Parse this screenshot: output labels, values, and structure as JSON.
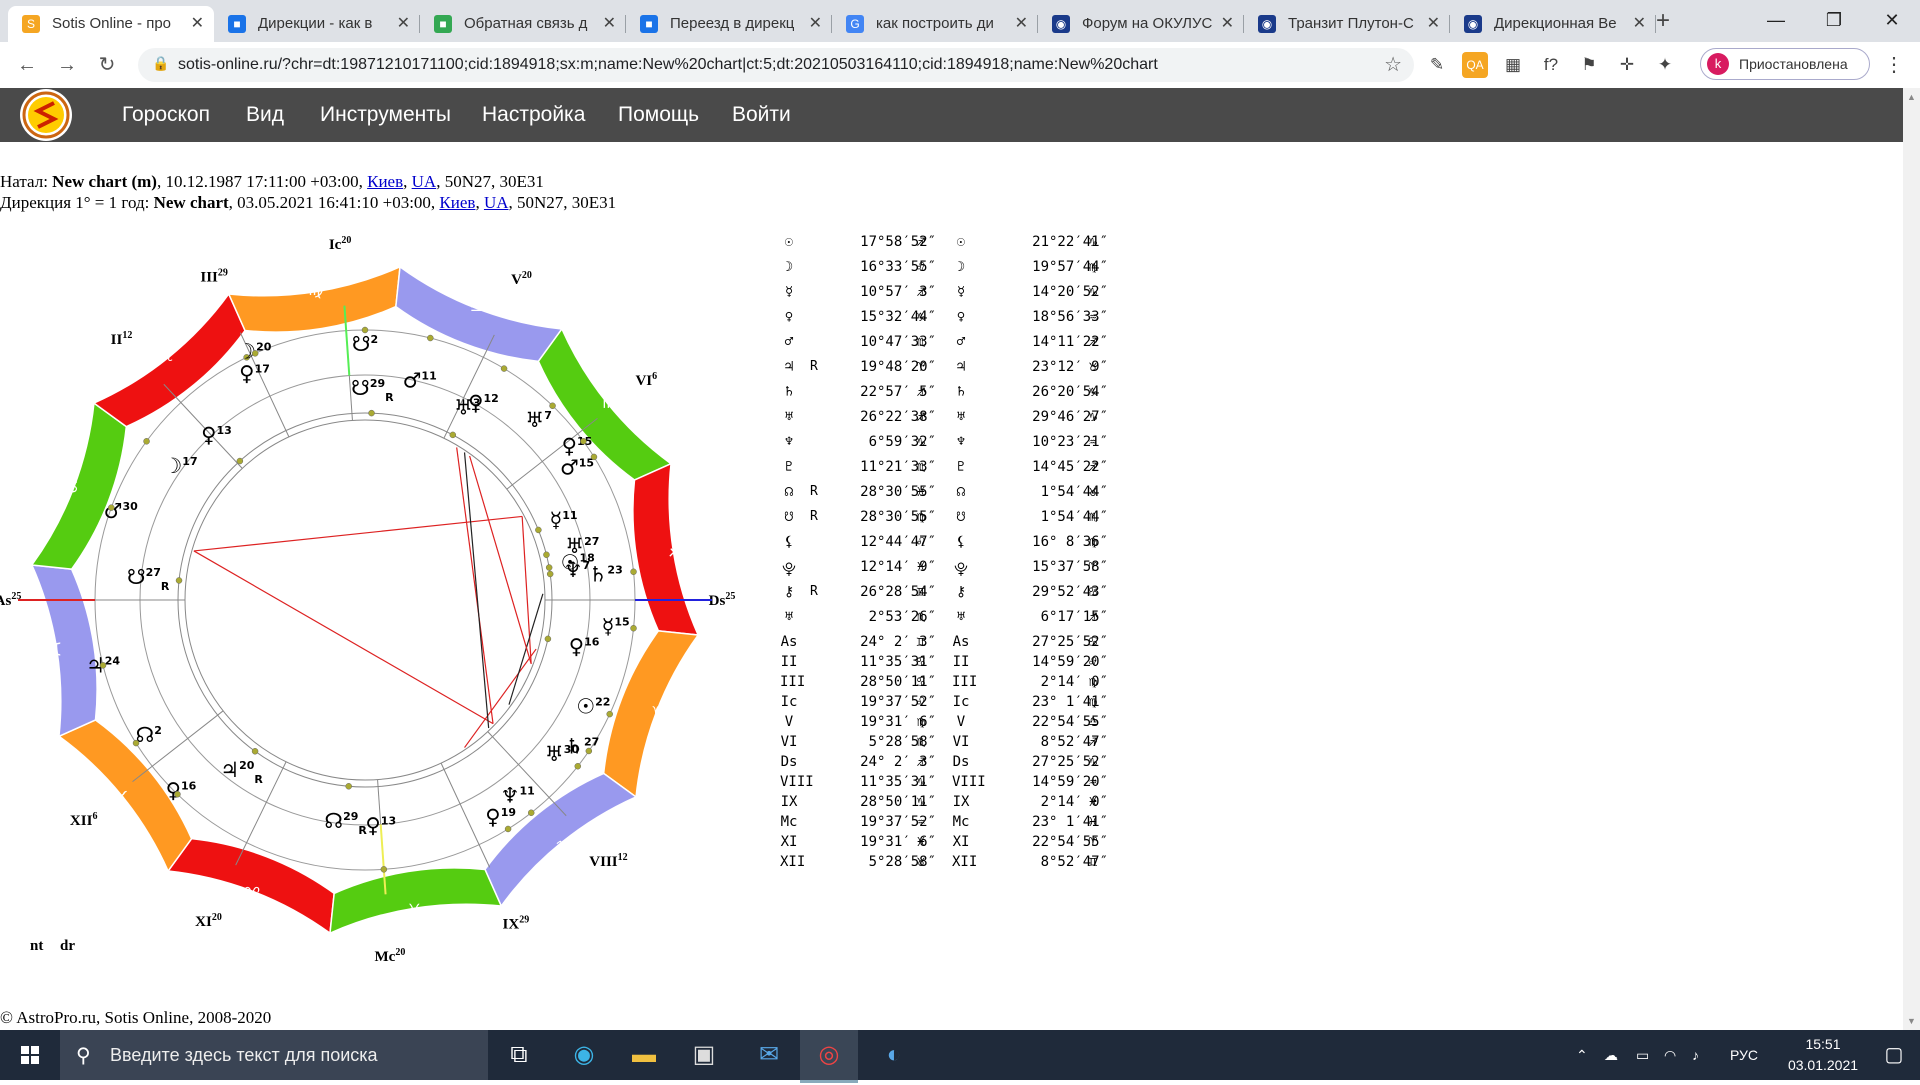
{
  "browser": {
    "tabs": [
      {
        "title": "Sotis Online - про",
        "active": true,
        "fav_color": "#f5a623",
        "fav_glyph": "S"
      },
      {
        "title": "Дирекции - как в",
        "active": false,
        "fav_color": "#1a73e8",
        "fav_glyph": "■"
      },
      {
        "title": "Обратная связь д",
        "active": false,
        "fav_color": "#34a853",
        "fav_glyph": "■"
      },
      {
        "title": "Переезд в дирекц",
        "active": false,
        "fav_color": "#1a73e8",
        "fav_glyph": "■"
      },
      {
        "title": "как построить ди",
        "active": false,
        "fav_color": "#4285f4",
        "fav_glyph": "G"
      },
      {
        "title": "Форум на ОКУЛУС",
        "active": false,
        "fav_color": "#1a3a8a",
        "fav_glyph": "◉"
      },
      {
        "title": "Транзит Плутон-С",
        "active": false,
        "fav_color": "#1a3a8a",
        "fav_glyph": "◉"
      },
      {
        "title": "Дирекционная Ве",
        "active": false,
        "fav_color": "#1a3a8a",
        "fav_glyph": "◉"
      }
    ],
    "close_glyph": "✕",
    "new_tab_glyph": "+",
    "minimize_glyph": "—",
    "maximize_glyph": "❐",
    "window_close_glyph": "✕",
    "back_glyph": "←",
    "forward_glyph": "→",
    "reload_glyph": "↻",
    "lock_glyph": "🔒",
    "url": "sotis-online.ru/?chr=dt:19871210171100;cid:1894918;sx:m;name:New%20chart|ct:5;dt:20210503164110;cid:1894918;name:New%20chart",
    "star_glyph": "☆",
    "extensions": [
      "✎",
      "QA",
      "▦",
      "f?",
      "⚑",
      "✛",
      "✦"
    ],
    "profile_initial": "k",
    "profile_status": "Приостановлена",
    "menu_glyph": "⋮"
  },
  "site": {
    "nav": [
      "Гороскоп",
      "Вид",
      "Инструменты",
      "Настройка",
      "Помощь",
      "Войти"
    ]
  },
  "natal": {
    "prefix": "Натал: ",
    "name": "New chart (m)",
    "datetime": ", 10.12.1987 17:11:00 +03:00, ",
    "city": "Киев",
    "country": "UA",
    "coords": ", 50N27, 30E31"
  },
  "direction": {
    "prefix": "Дирекция 1° = 1 год: ",
    "name": "New chart",
    "datetime": ", 03.05.2021 16:41:10 +03:00, ",
    "city": "Киев",
    "country": "UA",
    "coords": ", 50N27, 30E31"
  },
  "chart_labels": {
    "natal": "nt",
    "direction": "dr"
  },
  "zodiac_signs": [
    {
      "glyph": "♈",
      "color": "#ee1111"
    },
    {
      "glyph": "♉",
      "color": "#ff9922"
    },
    {
      "glyph": "♊",
      "color": "#9999ee"
    },
    {
      "glyph": "♋",
      "color": "#55cc11"
    },
    {
      "glyph": "♌",
      "color": "#ee1111"
    },
    {
      "glyph": "♍",
      "color": "#ff9922"
    },
    {
      "glyph": "♎",
      "color": "#9999ee"
    },
    {
      "glyph": "♏",
      "color": "#55cc11"
    },
    {
      "glyph": "♐",
      "color": "#ee1111"
    },
    {
      "glyph": "♑",
      "color": "#ff9922"
    },
    {
      "glyph": "♒",
      "color": "#9999ee"
    },
    {
      "glyph": "♓",
      "color": "#55cc11"
    }
  ],
  "house_labels": [
    {
      "label": "As",
      "deg": "25"
    },
    {
      "label": "II",
      "deg": "12"
    },
    {
      "label": "III",
      "deg": "29"
    },
    {
      "label": "Ic",
      "deg": "20"
    },
    {
      "label": "V",
      "deg": "20"
    },
    {
      "label": "VI",
      "deg": "6"
    },
    {
      "label": "Ds",
      "deg": "25"
    },
    {
      "label": "VIII",
      "deg": "12"
    },
    {
      "label": "IX",
      "deg": "29"
    },
    {
      "label": "Mc",
      "deg": "20"
    },
    {
      "label": "XI",
      "deg": "20"
    },
    {
      "label": "XII",
      "deg": "6"
    }
  ],
  "wheel_planets": [
    {
      "glyph": "☊",
      "deg": "2"
    },
    {
      "glyph": "♀",
      "deg": "16"
    },
    {
      "glyph": "♃",
      "deg": "24"
    },
    {
      "glyph": "♃",
      "deg": "20",
      "retro": "R"
    },
    {
      "glyph": "☊",
      "deg": "29",
      "retro": "R"
    },
    {
      "glyph": "♀",
      "deg": "13"
    },
    {
      "glyph": "♀",
      "deg": "19"
    },
    {
      "glyph": "♆",
      "deg": "11"
    },
    {
      "glyph": "♅",
      "deg": "30"
    },
    {
      "glyph": "♄",
      "deg": "27"
    },
    {
      "glyph": "☉",
      "deg": "22"
    },
    {
      "glyph": "♀",
      "deg": "16"
    },
    {
      "glyph": "☿",
      "deg": "15"
    },
    {
      "glyph": "♆",
      "deg": "7"
    },
    {
      "glyph": "♅",
      "deg": "27"
    },
    {
      "glyph": "♄",
      "deg": "23"
    },
    {
      "glyph": "☉",
      "deg": "18"
    },
    {
      "glyph": "☿",
      "deg": "11"
    },
    {
      "glyph": "♂",
      "deg": "15"
    },
    {
      "glyph": "♀",
      "deg": "15"
    },
    {
      "glyph": "♅",
      "deg": "7"
    },
    {
      "glyph": "♀",
      "deg": "12"
    },
    {
      "glyph": "♅",
      "deg": "3"
    },
    {
      "glyph": "♂",
      "deg": "11"
    },
    {
      "glyph": "☋",
      "deg": "2"
    },
    {
      "glyph": "☋",
      "deg": "29",
      "retro": "R"
    },
    {
      "glyph": "♀",
      "deg": "17"
    },
    {
      "glyph": "☽",
      "deg": "20"
    },
    {
      "glyph": "♀",
      "deg": "13"
    },
    {
      "glyph": "☽",
      "deg": "17"
    },
    {
      "glyph": "♂",
      "deg": "30"
    },
    {
      "glyph": "☋",
      "deg": "27",
      "retro": "R"
    }
  ],
  "positions": [
    {
      "g1": "☉",
      "r1": "",
      "v1": "17°58′52″",
      "s1": "♐",
      "g2": "☉",
      "v2": "21°22′41″",
      "s2": "♑"
    },
    {
      "g1": "☽",
      "r1": "",
      "v1": "16°33′55″",
      "s1": "♌",
      "g2": "☽",
      "v2": "19°57′44″",
      "s2": "♍"
    },
    {
      "g1": "☿",
      "r1": "",
      "v1": "10°57′ 3″",
      "s1": "♐",
      "g2": "☿",
      "v2": "14°20′52″",
      "s2": "♑"
    },
    {
      "g1": "♀",
      "r1": "",
      "v1": "15°32′44″",
      "s1": "♑",
      "g2": "♀",
      "v2": "18°56′33″",
      "s2": "♒"
    },
    {
      "g1": "♂",
      "r1": "",
      "v1": "10°47′33″",
      "s1": "♏",
      "g2": "♂",
      "v2": "14°11′22″",
      "s2": "♐"
    },
    {
      "g1": "♃",
      "r1": "R",
      "v1": "19°48′20″",
      "s1": "♈",
      "g2": "♃",
      "v2": "23°12′ 9″",
      "s2": "♉"
    },
    {
      "g1": "♄",
      "r1": "",
      "v1": "22°57′ 5″",
      "s1": "♐",
      "g2": "♄",
      "v2": "26°20′54″",
      "s2": "♑"
    },
    {
      "g1": "♅",
      "r1": "",
      "v1": "26°22′38″",
      "s1": "♐",
      "g2": "♅",
      "v2": "29°46′27″",
      "s2": "♑"
    },
    {
      "g1": "♆",
      "r1": "",
      "v1": "6°59′32″",
      "s1": "♑",
      "g2": "♆",
      "v2": "10°23′21″",
      "s2": "♒"
    },
    {
      "g1": "♇",
      "r1": "",
      "v1": "11°21′33″",
      "s1": "♏",
      "g2": "♇",
      "v2": "14°45′22″",
      "s2": "♐"
    },
    {
      "g1": "☊",
      "r1": "R",
      "v1": "28°30′55″",
      "s1": "♓",
      "g2": "☊",
      "v2": "1°54′44″",
      "s2": "♉"
    },
    {
      "g1": "☋",
      "r1": "R",
      "v1": "28°30′55″",
      "s1": "♍",
      "g2": "☋",
      "v2": "1°54′44″",
      "s2": "♏"
    },
    {
      "g1": "⚸",
      "r1": "",
      "v1": "12°44′47″",
      "s1": "♌",
      "g2": "⚸",
      "v2": "16° 8′36″",
      "s2": "♍"
    },
    {
      "g1": "⯓",
      "r1": "",
      "v1": "12°14′ 9″",
      "s1": "♓",
      "g2": "⯓",
      "v2": "15°37′58″",
      "s2": "♈"
    },
    {
      "g1": "⚷",
      "r1": "R",
      "v1": "26°28′54″",
      "s1": "♊",
      "g2": "⚷",
      "v2": "29°52′43″",
      "s2": "♋"
    },
    {
      "g1": "♅",
      "r1": "",
      "v1": "2°53′26″",
      "s1": "♏",
      "g2": "♅",
      "v2": "6°17′15″",
      "s2": "♐"
    },
    {
      "g1": "As",
      "r1": "",
      "v1": "24° 2′ 3″",
      "s1": "♊",
      "g2": "As",
      "v2": "27°25′52″",
      "s2": "♋"
    },
    {
      "g1": "II",
      "r1": "",
      "v1": "11°35′31″",
      "s1": "♋",
      "g2": "II",
      "v2": "14°59′20″",
      "s2": "♌"
    },
    {
      "g1": "III",
      "r1": "",
      "v1": "28°50′11″",
      "s1": "♋",
      "g2": "III",
      "v2": "2°14′ 0″",
      "s2": "♍"
    },
    {
      "g1": "Ic",
      "r1": "",
      "v1": "19°37′52″",
      "s1": "♌",
      "g2": "Ic",
      "v2": "23° 1′41″",
      "s2": "♍"
    },
    {
      "g1": "V",
      "r1": "",
      "v1": "19°31′ 6″",
      "s1": "♍",
      "g2": "V",
      "v2": "22°54′55″",
      "s2": "♎"
    },
    {
      "g1": "VI",
      "r1": "",
      "v1": "5°28′58″",
      "s1": "♏",
      "g2": "VI",
      "v2": "8°52′47″",
      "s2": "♐"
    },
    {
      "g1": "Ds",
      "r1": "",
      "v1": "24° 2′ 3″",
      "s1": "♐",
      "g2": "Ds",
      "v2": "27°25′52″",
      "s2": "♑"
    },
    {
      "g1": "VIII",
      "r1": "",
      "v1": "11°35′31″",
      "s1": "♑",
      "g2": "VIII",
      "v2": "14°59′20″",
      "s2": "♒"
    },
    {
      "g1": "IX",
      "r1": "",
      "v1": "28°50′11″",
      "s1": "♑",
      "g2": "IX",
      "v2": "2°14′ 0″",
      "s2": "♓"
    },
    {
      "g1": "Mc",
      "r1": "",
      "v1": "19°37′52″",
      "s1": "♒",
      "g2": "Mc",
      "v2": "23° 1′41″",
      "s2": "♓"
    },
    {
      "g1": "XI",
      "r1": "",
      "v1": "19°31′ 6″",
      "s1": "♓",
      "g2": "XI",
      "v2": "22°54′55″",
      "s2": "♈"
    },
    {
      "g1": "XII",
      "r1": "",
      "v1": "5°28′58″",
      "s1": "♉",
      "g2": "XII",
      "v2": "8°52′47″",
      "s2": "♊"
    }
  ],
  "footer": "© AstroPro.ru, Sotis Online, 2008-2020",
  "taskbar": {
    "search_placeholder": "Введите здесь текст для поиска",
    "lang": "РУС",
    "time": "15:51",
    "date": "03.01.2021"
  }
}
